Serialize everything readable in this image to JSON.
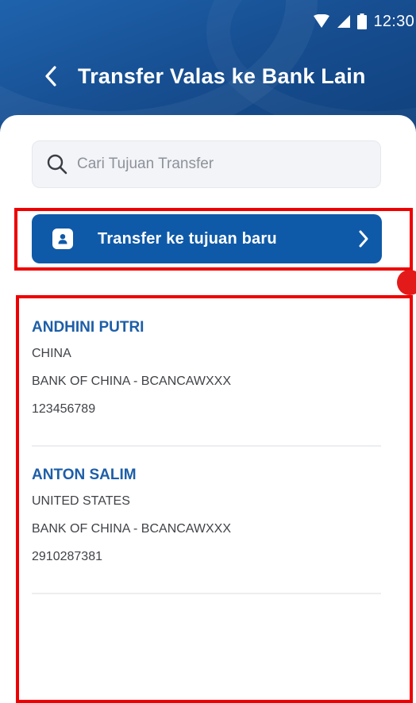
{
  "status_bar": {
    "time": "12:30",
    "icons": [
      "wifi-icon",
      "signal-icon",
      "battery-icon"
    ]
  },
  "header": {
    "title": "Transfer Valas ke Bank Lain",
    "back_icon": "chevron-left-icon"
  },
  "search": {
    "placeholder": "Cari Tujuan Transfer",
    "value": "",
    "icon": "search-icon"
  },
  "new_transfer": {
    "label": "Transfer ke tujuan baru",
    "icon": "person-icon",
    "chevron_icon": "chevron-right-icon"
  },
  "contacts": [
    {
      "name": "ANDHINI PUTRI",
      "country": "CHINA",
      "bank": "BANK OF CHINA  - BCANCAWXXX",
      "account": "123456789"
    },
    {
      "name": "ANTON SALIM",
      "country": "UNITED STATES",
      "bank": "BANK OF CHINA - BCANCAWXXX",
      "account": "2910287381"
    }
  ],
  "colors": {
    "header_blue": "#174f92",
    "button_blue": "#0f5aa8",
    "name_blue": "#1d5ea8",
    "annotation_red": "#ee0000"
  }
}
